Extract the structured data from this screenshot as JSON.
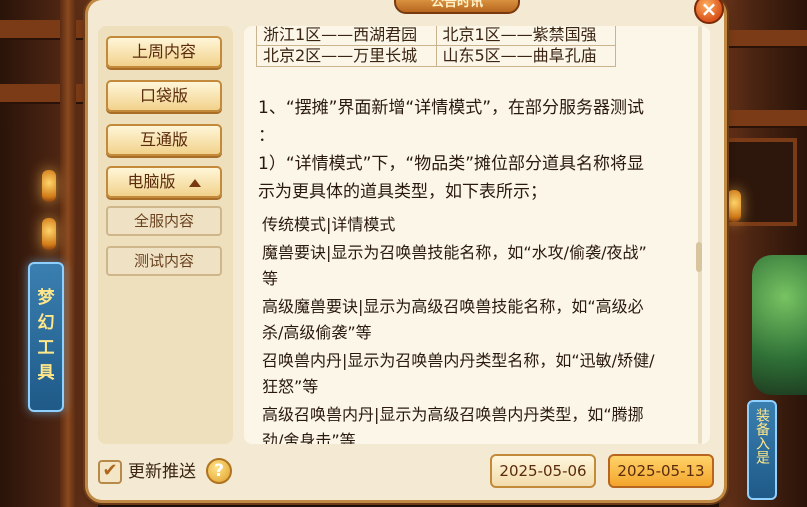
{
  "window": {
    "title": "公告时讯",
    "close_glyph": "×"
  },
  "sidebar": {
    "items": [
      {
        "label": "上周内容"
      },
      {
        "label": "口袋版"
      },
      {
        "label": "互通版"
      },
      {
        "label": "电脑版",
        "expanded": true
      }
    ],
    "subitems": [
      {
        "label": "全服内容"
      },
      {
        "label": "测试内容"
      }
    ]
  },
  "background": {
    "left_banner": "梦幻工具",
    "right_banner": "装备入是"
  },
  "content": {
    "table": {
      "rows": [
        [
          "浙江1区——西湖君园",
          "北京1区——紫禁国强"
        ],
        [
          "北京2区——万里长城",
          "山东5区——曲阜孔庙"
        ]
      ]
    },
    "intro_line1": "1、“摆摊”界面新增“详情模式”，在部分服务器测试",
    "intro_line2": "：",
    "detail_line1": "1）“详情模式”下，“物品类”摊位部分道具名称将显",
    "detail_line2": "示为更具体的道具类型，如下表所示；",
    "list_header": "传统模式|详情模式",
    "list": [
      {
        "line1": "魔兽要诀|显示为召唤兽技能名称，如“水攻/偷袭/夜战”",
        "line2": "等"
      },
      {
        "line1": "高级魔兽要诀|显示为高级召唤兽技能名称，如“高级必",
        "line2": "杀/高级偷袭”等"
      },
      {
        "line1": "召唤兽内丹|显示为召唤兽内丹类型名称，如“迅敏/矫健/",
        "line2": "狂怒”等"
      },
      {
        "line1": "高级召唤兽内丹|显示为高级召唤兽内丹类型，如“腾挪",
        "line2": "劲/舍身击”等"
      }
    ]
  },
  "footer": {
    "checkbox_label": "更新推送",
    "checkbox_checked": true,
    "help_glyph": "?",
    "dates": [
      "2025-05-06",
      "2025-05-13"
    ],
    "active_date_index": 1
  }
}
